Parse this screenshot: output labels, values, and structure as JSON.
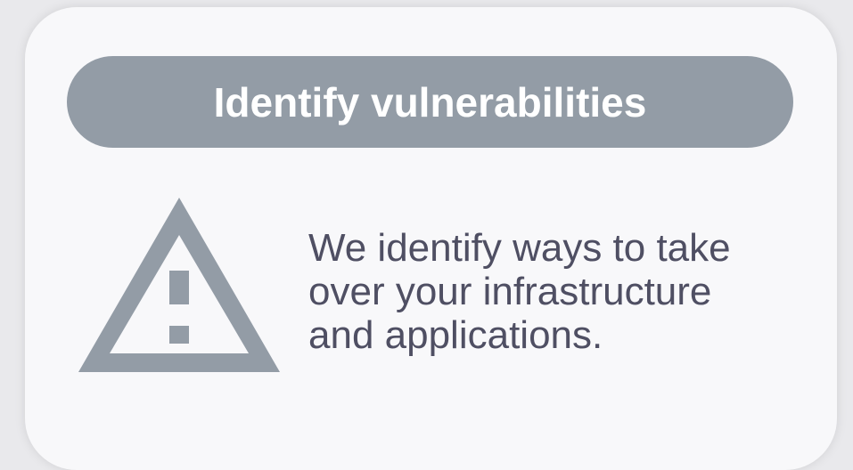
{
  "card": {
    "title": "Identify vulnerabilities",
    "icon": "warning-triangle-icon",
    "description": "We identify ways to take\nover  your infrastructure\nand applications."
  },
  "colors": {
    "card_background": "#f8f8fa",
    "pill_background": "#939ca6",
    "title_text": "#ffffff",
    "body_text": "#4f4f63",
    "icon": "#939ca6"
  }
}
